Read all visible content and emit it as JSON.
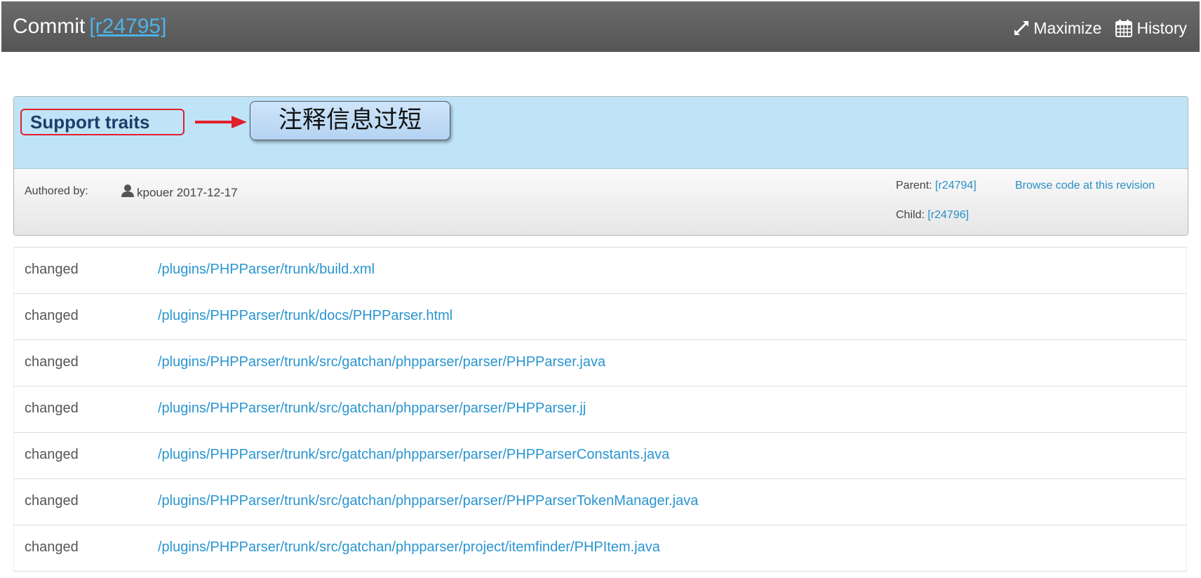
{
  "header": {
    "title": "Commit",
    "revision": "[r24795]",
    "maximize_label": "Maximize",
    "maximize_icon": "expand-arrows-icon",
    "history_label": "History",
    "history_icon": "calendar-icon"
  },
  "commit": {
    "message": "Support traits",
    "annotation": "注释信息过短",
    "authored_by_label": "Authored by:",
    "author_icon": "user-icon",
    "author": "kpouer 2017-12-17",
    "parent_label": "Parent:",
    "parent_rev": "[r24794]",
    "browse_label": "Browse code at this revision",
    "child_label": "Child:",
    "child_rev": "[r24796]"
  },
  "files": [
    {
      "status": "changed",
      "path": "/plugins/PHPParser/trunk/build.xml"
    },
    {
      "status": "changed",
      "path": "/plugins/PHPParser/trunk/docs/PHPParser.html"
    },
    {
      "status": "changed",
      "path": "/plugins/PHPParser/trunk/src/gatchan/phpparser/parser/PHPParser.java"
    },
    {
      "status": "changed",
      "path": "/plugins/PHPParser/trunk/src/gatchan/phpparser/parser/PHPParser.jj"
    },
    {
      "status": "changed",
      "path": "/plugins/PHPParser/trunk/src/gatchan/phpparser/parser/PHPParserConstants.java"
    },
    {
      "status": "changed",
      "path": "/plugins/PHPParser/trunk/src/gatchan/phpparser/parser/PHPParserTokenManager.java"
    },
    {
      "status": "changed",
      "path": "/plugins/PHPParser/trunk/src/gatchan/phpparser/project/itemfinder/PHPItem.java"
    }
  ],
  "colors": {
    "header_bg": "#606060",
    "link": "#2a95cf",
    "message_bg": "#bfe4f7",
    "annotation_border": "#e0202a",
    "annotation_arrow": "#e0202a"
  }
}
